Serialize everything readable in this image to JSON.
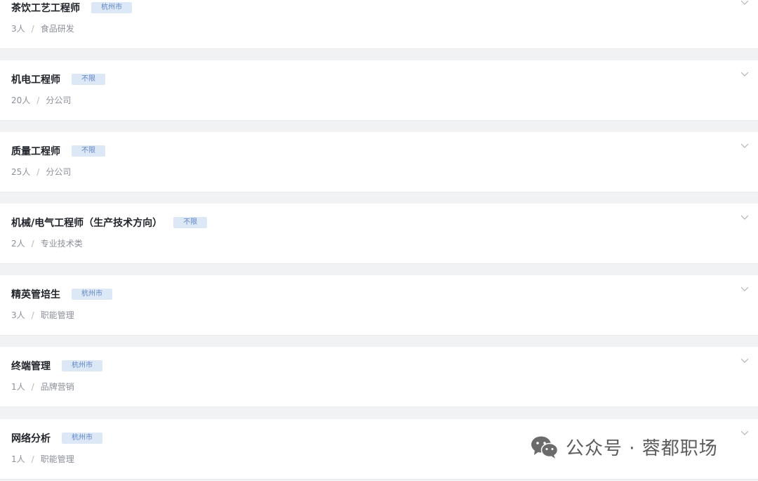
{
  "jobs": [
    {
      "title": "茶饮工艺工程师",
      "location": "杭州市",
      "headcount": "3人",
      "category": "食品研发"
    },
    {
      "title": "机电工程师",
      "location": "不限",
      "headcount": "20人",
      "category": "分公司"
    },
    {
      "title": "质量工程师",
      "location": "不限",
      "headcount": "25人",
      "category": "分公司"
    },
    {
      "title": "机械/电气工程师（生产技术方向）",
      "location": "不限",
      "headcount": "2人",
      "category": "专业技术类"
    },
    {
      "title": "精英管培生",
      "location": "杭州市",
      "headcount": "3人",
      "category": "职能管理"
    },
    {
      "title": "终端管理",
      "location": "杭州市",
      "headcount": "1人",
      "category": "品牌营销"
    },
    {
      "title": "网络分析",
      "location": "杭州市",
      "headcount": "1人",
      "category": "职能管理"
    }
  ],
  "separator": "/",
  "expand_icon": "chevron-down-icon",
  "watermark": {
    "icon": "wechat-icon",
    "text": "公众号 · 蓉都职场"
  },
  "colors": {
    "tag_bg": "#dde8f7",
    "tag_text": "#5f86c4",
    "page_bg": "#f1f2f4"
  }
}
